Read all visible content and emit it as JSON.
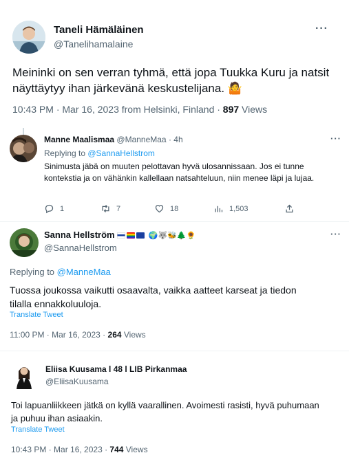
{
  "main_tweet": {
    "author_name": "Taneli Hämäläinen",
    "author_handle": "@Tanelihamalaine",
    "text": "Meininki on sen verran tyhmä, että jopa Tuukka Kuru ja natsit näyttäytyy ihan järkevänä keskustelijana. 🤷",
    "timestamp": "10:43 PM · Mar 16, 2023 from Helsinki, Finland · ",
    "views_count": "897",
    "views_label": " Views"
  },
  "reply1": {
    "author_name": "Manne Maalismaa",
    "author_handle": "@ManneMaa · 4h",
    "replying_prefix": "Replying to ",
    "replying_handle": "@SannaHellstrom",
    "text": "Sinimusta jäbä on muuten pelottavan hyvä ulosannissaan. Jos ei tunne kontekstia ja on vähänkin kallellaan natsahteluun, niin menee läpi ja lujaa.",
    "replies": "1",
    "retweets": "7",
    "likes": "18",
    "views": "1,503"
  },
  "reply2": {
    "author_name": "Sanna Hellström",
    "author_emoji": "🌍🐺🐝🌲🌻",
    "author_handle": "@SannaHellstrom",
    "replying_prefix": "Replying to ",
    "replying_handle": "@ManneMaa",
    "text": "Tuossa joukossa vaikutti osaavalta, vaikka aatteet karseat ja tiedon tilalla ennakkoluuloja.",
    "translate": "Translate Tweet",
    "timestamp": "11:00 PM · Mar 16, 2023 · ",
    "views_count": "264",
    "views_label": " Views"
  },
  "reply3": {
    "author_name": "Eliisa Kuusama l 48 l LIB Pirkanmaa",
    "author_handle": "@EliisaKuusama",
    "text": "Toi lapuanliikkeen jätkä on kyllä vaarallinen. Avoimesti rasisti, hyvä puhumaan ja puhuu ihan asiaakin.",
    "translate": "Translate Tweet",
    "timestamp": "10:43 PM · Mar 16, 2023 · ",
    "views_count": "744",
    "views_label": " Views"
  },
  "more_label": "···",
  "colors": {
    "link": "#1d9bf0",
    "muted": "#536471",
    "text": "#0f1419"
  }
}
